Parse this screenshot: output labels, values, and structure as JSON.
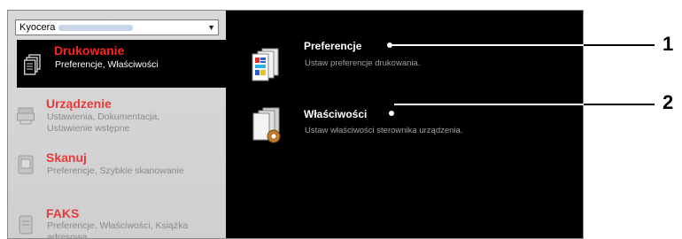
{
  "device_select": {
    "value": "Kyocera"
  },
  "sidebar": {
    "items": [
      {
        "title": "Drukowanie",
        "subtitle": "Preferencje, Właściwości"
      },
      {
        "title": "Urządzenie",
        "subtitle_line1": "Ustawienia, Dokumentacja,",
        "subtitle_line2": "Ustawienie wstępne"
      },
      {
        "title": "Skanuj",
        "subtitle": "Preferencje, Szybkie skanowanie"
      },
      {
        "title": "FAKS",
        "subtitle_line1": "Preferencje, Właściwości, Książka",
        "subtitle_line2": "adresowa"
      }
    ]
  },
  "content": {
    "entries": [
      {
        "title": "Preferencje",
        "description": "Ustaw preferencje drukowania."
      },
      {
        "title": "Właściwości",
        "description": "Ustaw właściwości sterownika urządzenia."
      }
    ]
  },
  "callouts": [
    "1",
    "2"
  ]
}
